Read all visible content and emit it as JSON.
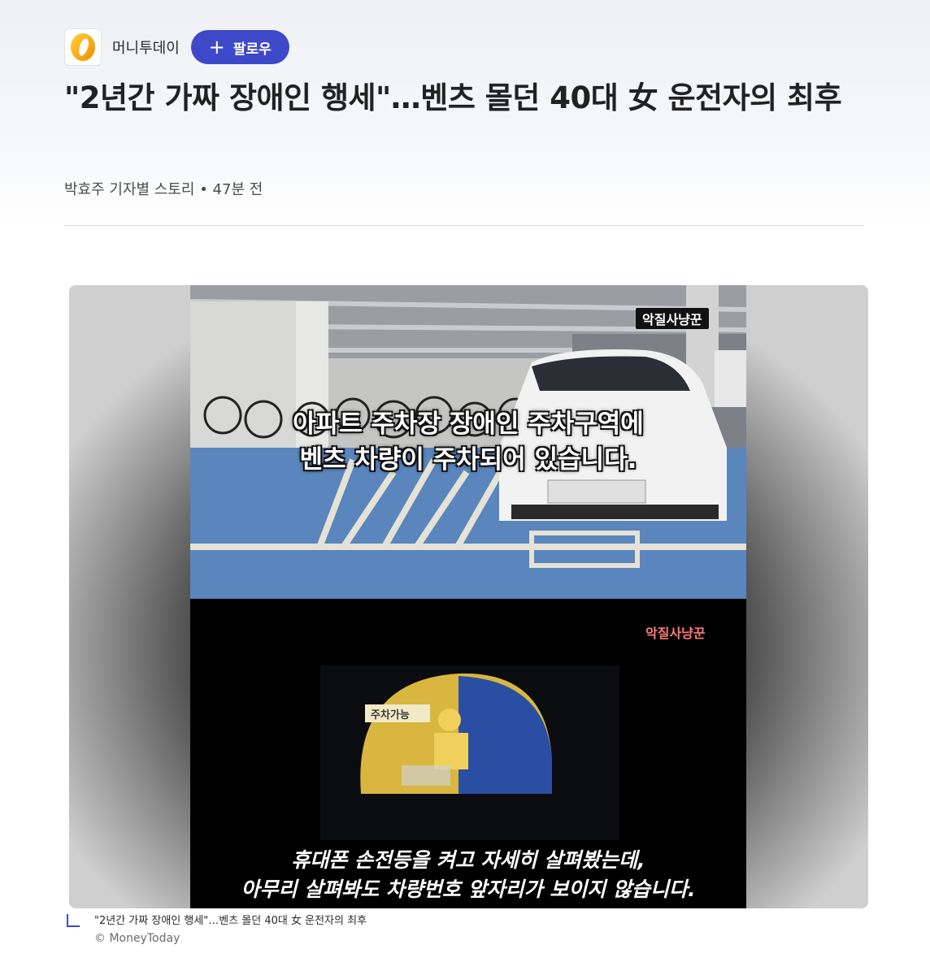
{
  "publisher": {
    "name": "머니투데이",
    "logo_icon": "moneytoday-logo-icon",
    "follow_label": "팔로우",
    "follow_icon": "plus-icon",
    "accent_color": "#3d49c9"
  },
  "article": {
    "headline": "\"2년간 가짜 장애인 행세\"…벤츠 몰던 40대 女 운전자의 최후",
    "byline": "박효주 기자별 스토리 • 47분 전"
  },
  "media": {
    "top_watermark": "악질사냥꾼",
    "top_caption_line1": "아파트 주차장 장애인 주차구역에",
    "top_caption_line2": "벤츠 차량이 주차되어 있습니다.",
    "bottom_watermark": "악질사냥꾼",
    "sticker_text": "주차가능",
    "bottom_caption_line1": "휴대폰 손전등을 켜고 자세히 살펴봤는데,",
    "bottom_caption_line2": "아무리 살펴봐도 차량번호 앞자리가 보이지 않습니다."
  },
  "image_caption": {
    "text": "\"2년간 가짜 장애인 행세\"…벤츠 몰던 40대 女 운전자의 최후",
    "credit": "© MoneyToday",
    "icon": "corner-caption-icon"
  }
}
